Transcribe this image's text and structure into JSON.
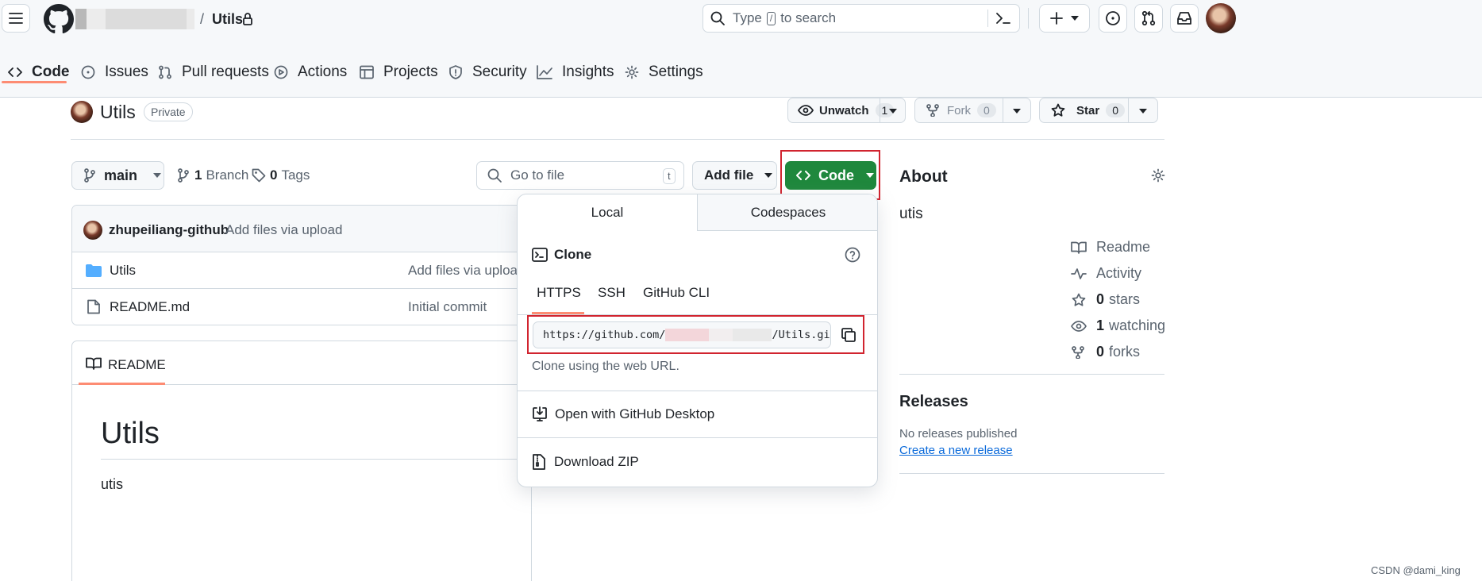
{
  "header": {
    "owner_redacted": "",
    "separator": "/",
    "repo_name": "Utils",
    "search_placeholder_pre": "Type",
    "search_key": "/",
    "search_placeholder_post": "to search"
  },
  "nav_tabs": [
    {
      "label": "Code"
    },
    {
      "label": "Issues"
    },
    {
      "label": "Pull requests"
    },
    {
      "label": "Actions"
    },
    {
      "label": "Projects"
    },
    {
      "label": "Security"
    },
    {
      "label": "Insights"
    },
    {
      "label": "Settings"
    }
  ],
  "repo": {
    "title": "Utils",
    "visibility": "Private",
    "unwatch_label": "Unwatch",
    "unwatch_count": "1",
    "fork_label": "Fork",
    "fork_count": "0",
    "star_label": "Star",
    "star_count": "0"
  },
  "toolbar": {
    "branch": "main",
    "branch_count": "1",
    "branch_label": "Branch",
    "tag_count": "0",
    "tag_label": "Tags",
    "goto_placeholder": "Go to file",
    "goto_key": "t",
    "add_file": "Add file",
    "code_button": "Code"
  },
  "commit": {
    "author": "zhupeiliang-github",
    "message": "Add files via upload"
  },
  "files": [
    {
      "name": "Utils",
      "type": "folder",
      "message": "Add files via upload"
    },
    {
      "name": "README.md",
      "type": "file",
      "message": "Initial commit"
    }
  ],
  "readme": {
    "tab_label": "README",
    "heading": "Utils",
    "body": "utis"
  },
  "clone_dropdown": {
    "tab_local": "Local",
    "tab_codespaces": "Codespaces",
    "clone_title": "Clone",
    "protocols": [
      "HTTPS",
      "SSH",
      "GitHub CLI"
    ],
    "url_prefix": "https://github.com/",
    "url_suffix": "/Utils.git",
    "hint": "Clone using the web URL.",
    "open_desktop": "Open with GitHub Desktop",
    "download_zip": "Download ZIP"
  },
  "about": {
    "title": "About",
    "description": "utis",
    "readme": "Readme",
    "activity": "Activity",
    "stars_count": "0",
    "stars_label": "stars",
    "watching_count": "1",
    "watching_label": "watching",
    "forks_count": "0",
    "forks_label": "forks"
  },
  "releases": {
    "title": "Releases",
    "none": "No releases published",
    "create_link": "Create a new release"
  },
  "watermark": "CSDN @dami_king",
  "colors": {
    "accent_green": "#1f883d",
    "highlight_red": "#d1242f",
    "link_blue": "#0969da",
    "tab_underline": "#fd8c73"
  }
}
